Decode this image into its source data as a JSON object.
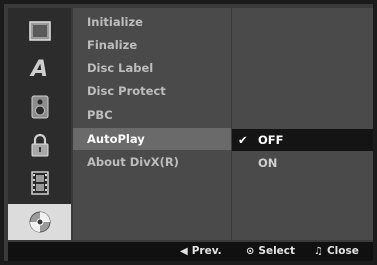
{
  "sidebar": {
    "icons": [
      {
        "name": "disc-tray-icon"
      },
      {
        "name": "language-icon",
        "glyph": "A"
      },
      {
        "name": "speaker-icon"
      },
      {
        "name": "lock-icon"
      },
      {
        "name": "film-strip-icon"
      },
      {
        "name": "disc-icon"
      }
    ],
    "selected_index": 5
  },
  "menu": {
    "items": [
      {
        "label": "Initialize"
      },
      {
        "label": "Finalize"
      },
      {
        "label": "Disc Label"
      },
      {
        "label": "Disc Protect"
      },
      {
        "label": "PBC"
      },
      {
        "label": "AutoPlay"
      },
      {
        "label": "About DivX(R)"
      }
    ],
    "selected_index": 5
  },
  "options": {
    "items": [
      {
        "label": "OFF",
        "checked": true
      },
      {
        "label": "ON",
        "checked": false
      }
    ],
    "check_glyph": "✔"
  },
  "footer": {
    "prev": {
      "glyph": "◀",
      "label": "Prev."
    },
    "select": {
      "glyph": "⊙",
      "label": "Select"
    },
    "close": {
      "glyph": "♫",
      "label": "Close"
    }
  }
}
